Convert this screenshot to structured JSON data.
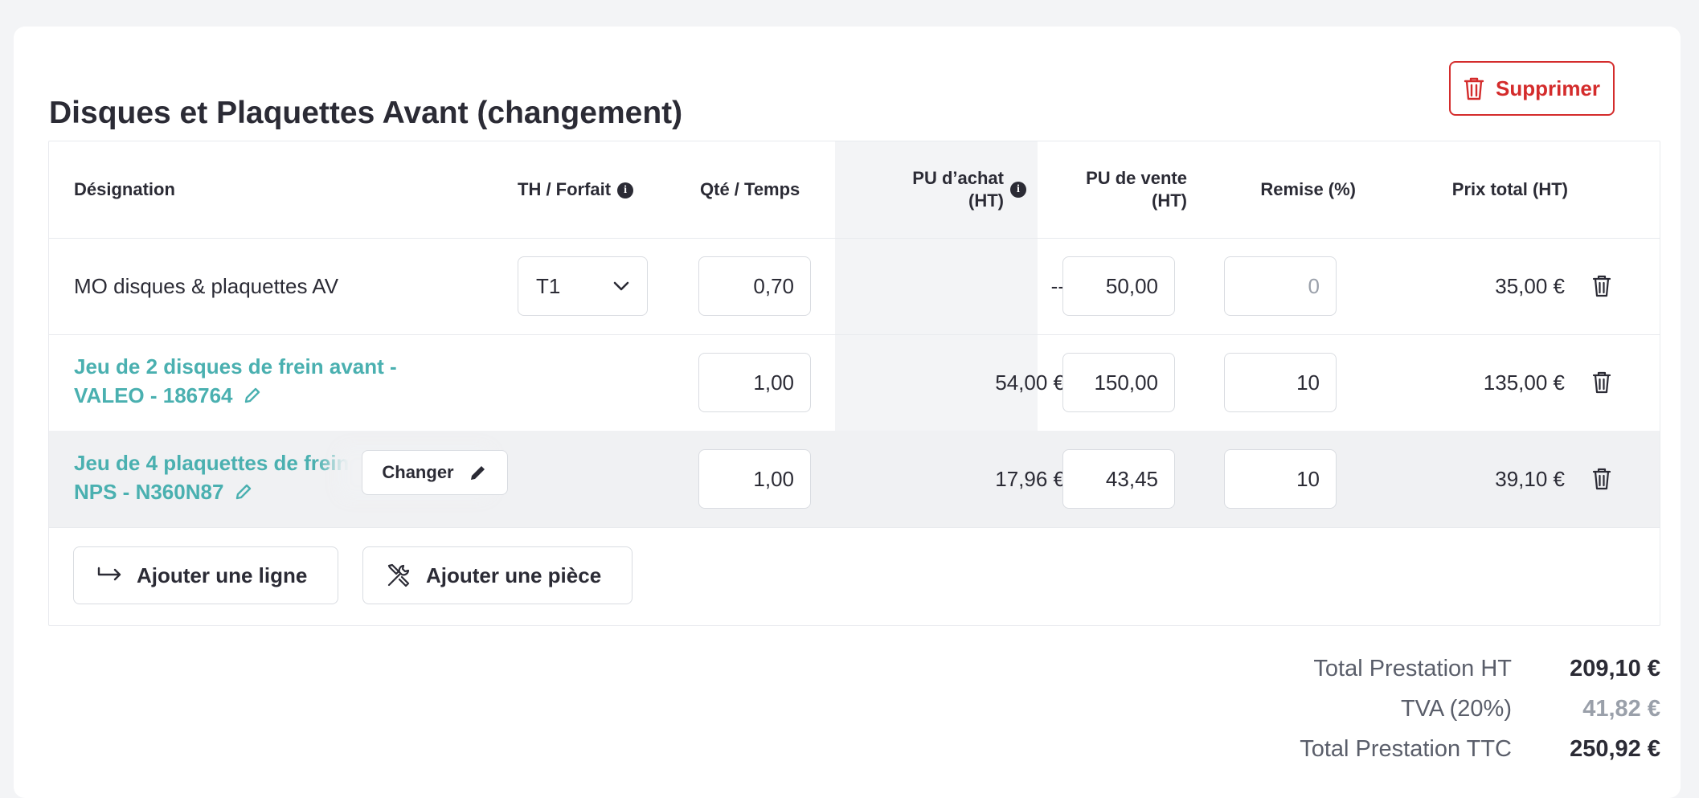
{
  "header": {
    "title": "Disques et Plaquettes Avant (changement)",
    "delete_label": "Supprimer",
    "accent_color": "#d42c2c"
  },
  "table": {
    "columns": {
      "designation": "Désignation",
      "th_forfait": "TH / Forfait",
      "qty_time": "Qté / Temps",
      "pu_achat_line1": "PU d’achat",
      "pu_achat_line2": "(HT)",
      "pu_vente_line1": "PU de vente",
      "pu_vente_line2": "(HT)",
      "remise": "Remise (%)",
      "prix_total": "Prix total (HT)"
    },
    "rows": [
      {
        "designation": "MO disques & plaquettes AV",
        "th": "T1",
        "qty": "0,70",
        "pu_achat": "--",
        "pu_vente": "50,00",
        "remise": "0",
        "total": "35,00 €"
      },
      {
        "designation_line1": "Jeu de 2 disques de frein avant -",
        "designation_line2": "VALEO - 186764",
        "qty": "1,00",
        "pu_achat": "54,00 €",
        "pu_vente": "150,00",
        "remise": "10",
        "total": "135,00 €"
      },
      {
        "designation_line1": "Jeu de 4 plaquettes de frein",
        "designation_line2": "NPS - N360N87",
        "changer_label": "Changer",
        "qty": "1,00",
        "pu_achat": "17,96 €",
        "pu_vente": "43,45",
        "remise": "10",
        "total": "39,10 €"
      }
    ],
    "add_line_label": "Ajouter une ligne",
    "add_part_label": "Ajouter une pièce"
  },
  "totals": {
    "ht_label": "Total Prestation HT",
    "ht_value": "209,10 €",
    "tva_label": "TVA (20%)",
    "tva_value": "41,82 €",
    "ttc_label": "Total Prestation TTC",
    "ttc_value": "250,92 €"
  },
  "icons": {
    "link_color": "#4ab0b0",
    "trash": "trash-icon",
    "edit": "pencil-icon",
    "info": "info-icon",
    "chevron": "chevron-down-icon",
    "add_line": "arrow-return-icon",
    "add_part": "tools-icon"
  }
}
